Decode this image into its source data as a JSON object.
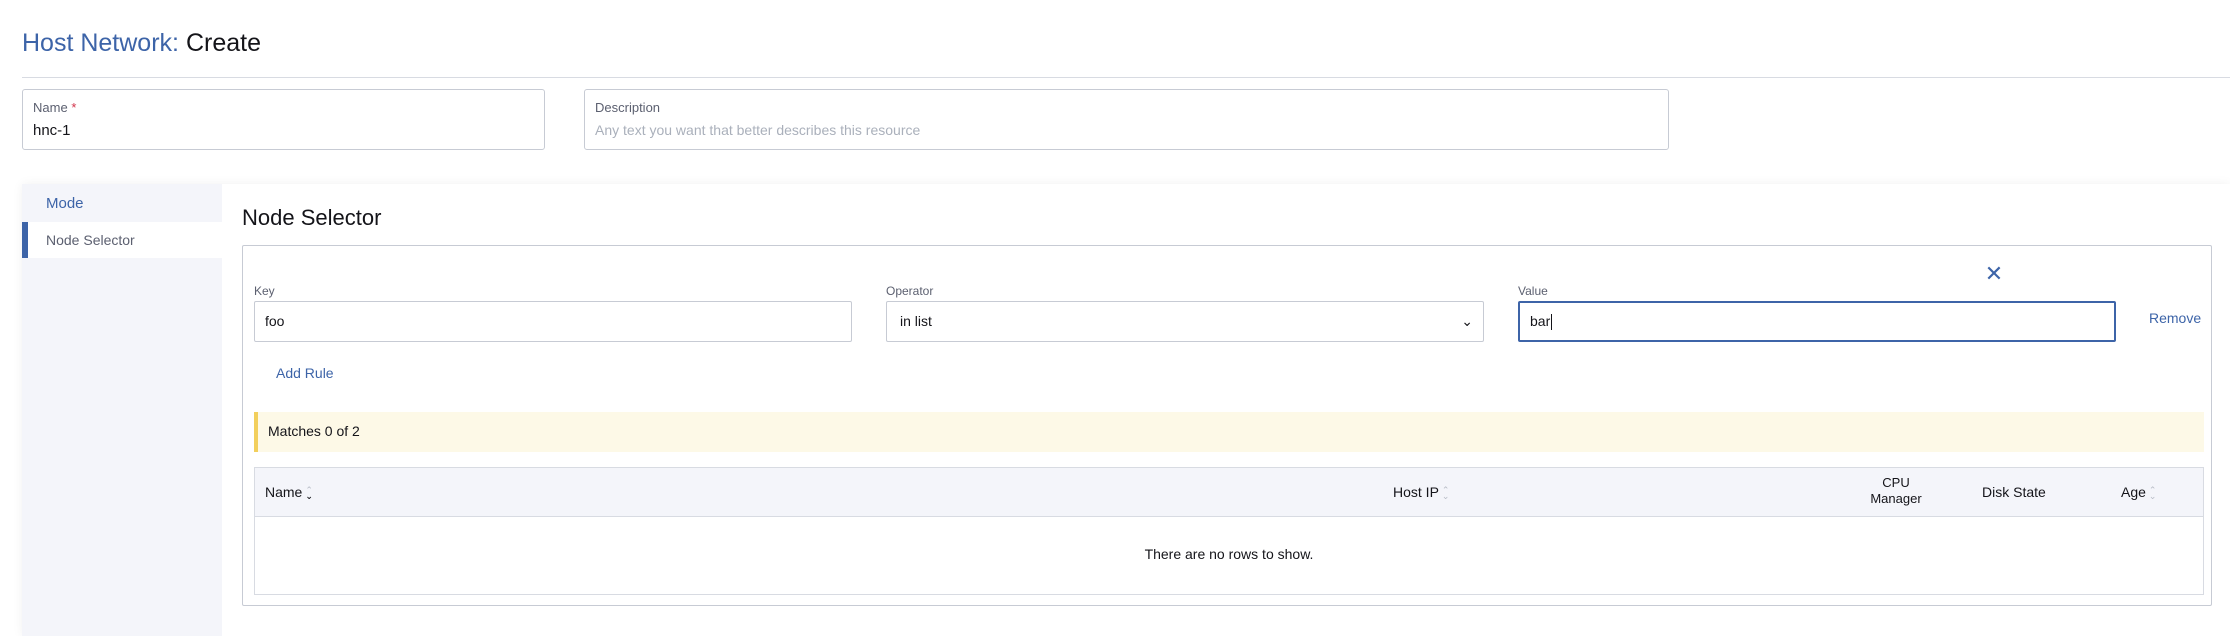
{
  "header": {
    "title_prefix": "Host Network:",
    "title_action": "Create"
  },
  "form": {
    "name": {
      "label": "Name",
      "required_mark": "*",
      "value": "hnc-1"
    },
    "description": {
      "label": "Description",
      "placeholder": "Any text you want that better describes this resource",
      "value": ""
    }
  },
  "sidebar": {
    "items": [
      {
        "label": "Mode",
        "active": false
      },
      {
        "label": "Node Selector",
        "active": true
      }
    ]
  },
  "node_selector": {
    "title": "Node Selector",
    "columns": {
      "key": "Key",
      "operator": "Operator",
      "value": "Value"
    },
    "rule": {
      "key": "foo",
      "operator": "in list",
      "value": "bar"
    },
    "remove_label": "Remove",
    "add_rule_label": "Add Rule",
    "close_icon": "close-icon",
    "match_banner": "Matches 0 of 2",
    "table": {
      "headers": [
        "Name",
        "Host IP",
        "CPU Manager",
        "Disk State",
        "Age"
      ],
      "empty_message": "There are no rows to show."
    }
  },
  "colors": {
    "accent": "#3d64a8",
    "banner_bg": "#fdf9e7",
    "banner_border": "#f2cf5c",
    "required": "#d2334a"
  }
}
